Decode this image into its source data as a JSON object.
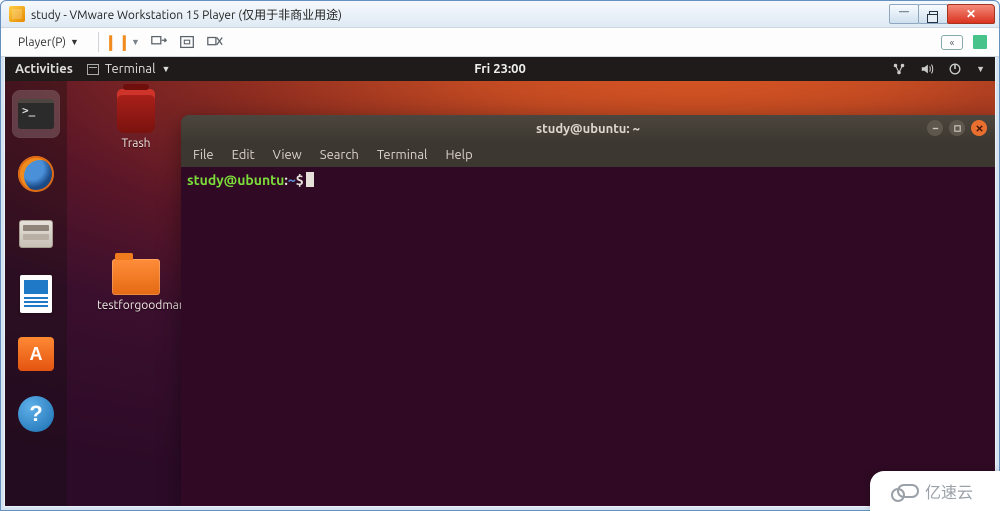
{
  "window": {
    "title": "study - VMware Workstation 15 Player (仅用于非商业用途)"
  },
  "vm_toolbar": {
    "player_label": "Player(P)"
  },
  "gnome": {
    "activities": "Activities",
    "app_label": "Terminal",
    "clock": "Fri 23:00"
  },
  "desktop_icons": {
    "trash": "Trash",
    "folder1": "testforgoodman"
  },
  "terminal": {
    "title": "study@ubuntu: ~",
    "menus": [
      "File",
      "Edit",
      "View",
      "Search",
      "Terminal",
      "Help"
    ],
    "ps1_userhost": "study@ubuntu",
    "ps1_path": "~",
    "ps1_symbol": "$"
  },
  "watermark": "亿速云"
}
